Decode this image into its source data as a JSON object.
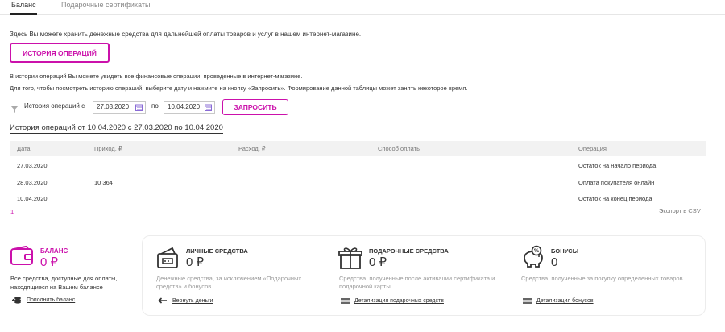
{
  "tabs": [
    {
      "label": "Баланс",
      "active": true
    },
    {
      "label": "Подарочные сертификаты",
      "active": false
    }
  ],
  "intro": "Здесь Вы можете хранить денежные средства для дальнейшей оплаты товаров и услуг в нашем интернет-магазине.",
  "history_button": "ИСТОРИЯ ОПЕРАЦИЙ",
  "history_info_1": "В истории операций Вы можете увидеть все финансовые операции, проведенные в интернет-магазине.",
  "history_info_2": "Для того, чтобы посмотреть историю операций, выберите дату и нажмите на кнопку «Запросить». Формирование данной таблицы может занять некоторое время.",
  "filter": {
    "label_from": "История операций с",
    "date_from": "27.03.2020",
    "label_to": "по",
    "date_to": "10.04.2020",
    "request_button": "ЗАПРОСИТЬ"
  },
  "history_title": "История операций от 10.04.2020 с 27.03.2020 по 10.04.2020",
  "table": {
    "headers": [
      "Дата",
      "Приход, ₽",
      "Расход, ₽",
      "Способ оплаты",
      "Операция"
    ],
    "rows": [
      [
        "27.03.2020",
        "",
        "",
        "",
        "Остаток на начало периода"
      ],
      [
        "28.03.2020",
        "10 364",
        "",
        "",
        "Оплата покупателя онлайн"
      ],
      [
        "10.04.2020",
        "",
        "",
        "",
        "Остаток на конец периода"
      ]
    ]
  },
  "pagination": "1",
  "export": "Экспорт в CSV",
  "balance": {
    "title": "БАЛАНС",
    "amount": "0 ₽",
    "desc": "Все средства, доступные для оплаты, находящиеся на Вашем балансе",
    "link": "Пополнить баланс"
  },
  "funds": [
    {
      "title": "ЛИЧНЫЕ СРЕДСТВА",
      "amount": "0 ₽",
      "desc": "Денежные средства, за исключением «Подарочных средств» и бонусов",
      "link": "Вернуть деньги",
      "icon": "wallet-icon"
    },
    {
      "title": "ПОДАРОЧНЫЕ СРЕДСТВА",
      "amount": "0 ₽",
      "desc": "Средства, полученные после активации сертификата и подарочной карты",
      "link": "Детализация подарочных средств",
      "icon": "gift-icon"
    },
    {
      "title": "БОНУСЫ",
      "amount": "0",
      "desc": "Средства, полученные за покупку определенных товаров",
      "link": "Детализация бонусов",
      "icon": "piggy-bank-icon"
    }
  ],
  "colors": {
    "accent": "#cb11ab",
    "header_bg": "#f2f2f2",
    "muted": "#999999"
  }
}
